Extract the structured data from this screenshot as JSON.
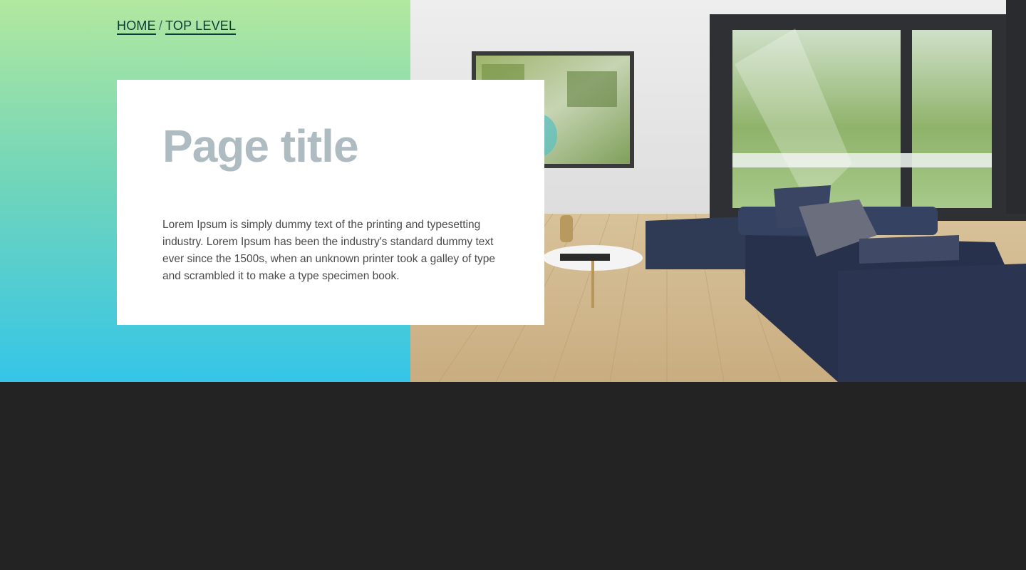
{
  "breadcrumb": {
    "items": [
      {
        "label": "HOME"
      },
      {
        "label": "TOP LEVEL"
      }
    ],
    "separator": "/"
  },
  "hero": {
    "title": "Page title",
    "description": "Lorem Ipsum is simply dummy text of the printing and typesetting industry. Lorem Ipsum has been the industry's standard dummy text ever since the 1500s, when an unknown printer took a galley of type and scrambled it to make a type specimen book."
  },
  "colors": {
    "gradient_top": "#b2e89f",
    "gradient_bottom": "#35c5e8",
    "breadcrumb_text": "#0d3a3a",
    "title_text": "#aebbc0",
    "body_text": "#4a4a4a",
    "footer_bg": "#232323"
  }
}
